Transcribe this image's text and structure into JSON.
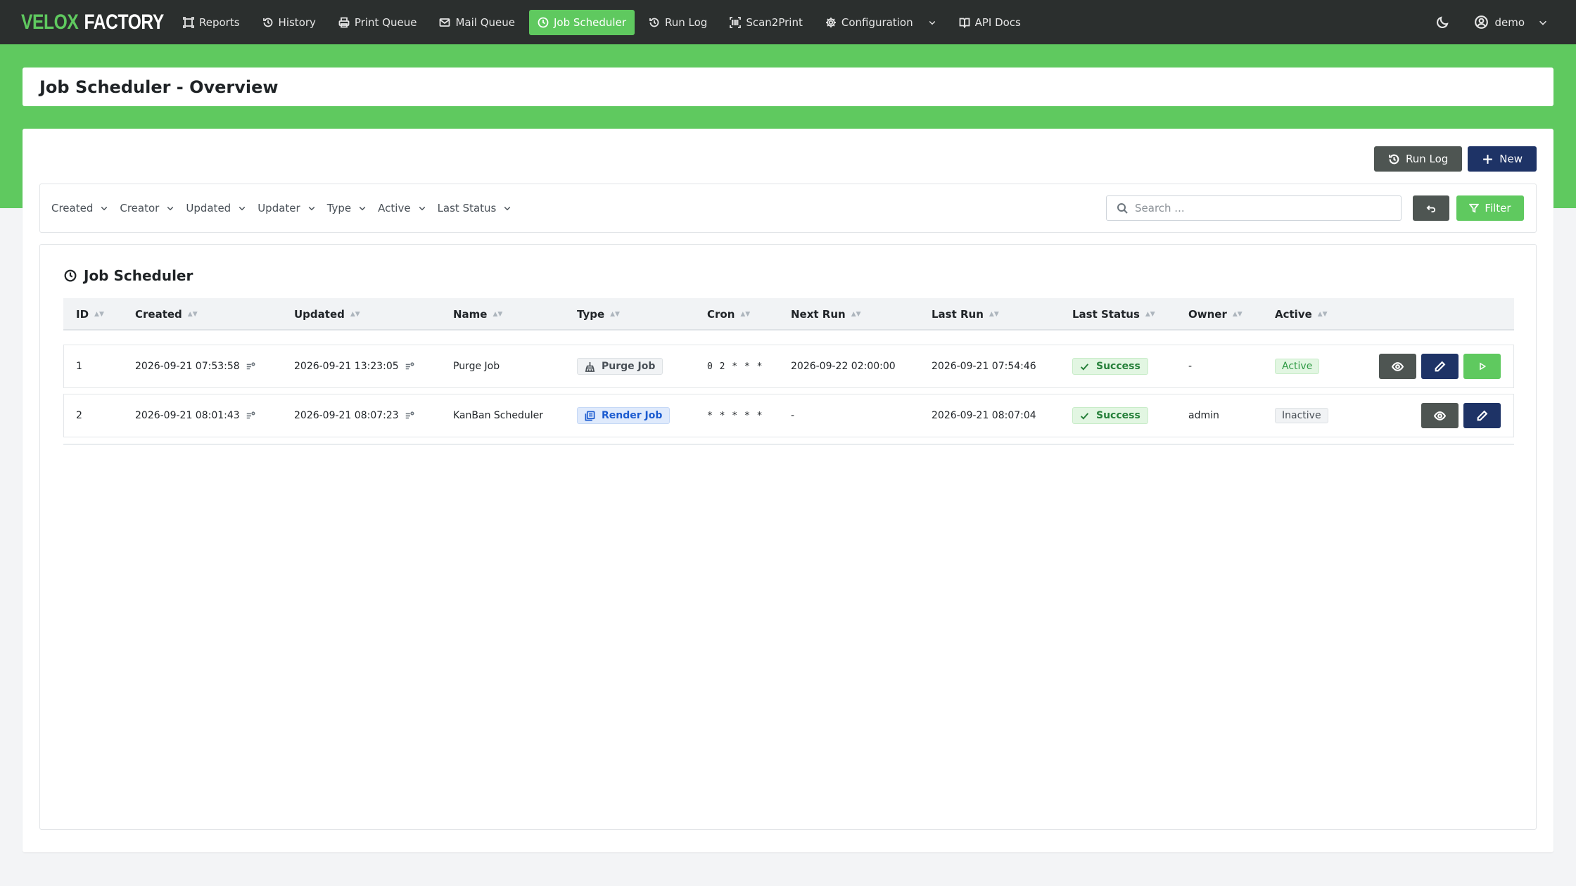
{
  "brand": {
    "part1": "VELOX",
    "part2": "FACTORY"
  },
  "nav": {
    "items": [
      {
        "label": "Reports",
        "icon": "reports-icon"
      },
      {
        "label": "History",
        "icon": "history-icon"
      },
      {
        "label": "Print Queue",
        "icon": "printer-icon"
      },
      {
        "label": "Mail Queue",
        "icon": "mail-icon"
      },
      {
        "label": "Job Scheduler",
        "icon": "clock-icon",
        "active": true
      },
      {
        "label": "Run Log",
        "icon": "history-icon"
      },
      {
        "label": "Scan2Print",
        "icon": "scan-icon"
      },
      {
        "label": "Configuration",
        "icon": "gear-icon",
        "dropdown": true
      },
      {
        "label": "API Docs",
        "icon": "book-icon"
      }
    ],
    "user": "demo"
  },
  "page": {
    "title": "Job Scheduler - Overview"
  },
  "actions": {
    "run_log": "Run Log",
    "new": "New"
  },
  "filters": {
    "items": [
      "Created",
      "Creator",
      "Updated",
      "Updater",
      "Type",
      "Active",
      "Last Status"
    ],
    "search_placeholder": "Search ...",
    "filter_label": "Filter"
  },
  "table": {
    "title": "Job Scheduler",
    "columns": [
      "ID",
      "Created",
      "Updated",
      "Name",
      "Type",
      "Cron",
      "Next Run",
      "Last Run",
      "Last Status",
      "Owner",
      "Active"
    ],
    "rows": [
      {
        "id": "1",
        "created": "2026-09-21 07:53:58",
        "updated": "2026-09-21 13:23:05",
        "name": "Purge Job",
        "type": "Purge Job",
        "cron": "0 2 * * *",
        "next_run": "2026-09-22 02:00:00",
        "last_run": "2026-09-21 07:54:46",
        "last_status": "Success",
        "owner": "-",
        "active": "Active"
      },
      {
        "id": "2",
        "created": "2026-09-21 08:01:43",
        "updated": "2026-09-21 08:07:23",
        "name": "KanBan Scheduler",
        "type": "Render Job",
        "cron": "* * * * *",
        "next_run": "-",
        "last_run": "2026-09-21 08:07:04",
        "last_status": "Success",
        "owner": "admin",
        "active": "Inactive"
      }
    ]
  },
  "colors": {
    "nav_bg": "#2b2f2e",
    "accent_green": "#5fc95f",
    "navy": "#1e3366",
    "dark_btn": "#4e5552",
    "render_blue": "#1b5bd0"
  }
}
